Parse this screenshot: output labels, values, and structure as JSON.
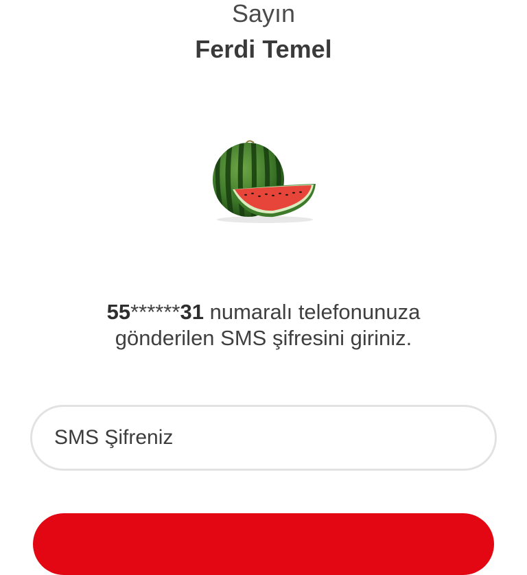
{
  "header": {
    "greeting": "Sayın",
    "name": "Ferdi Temel"
  },
  "image": {
    "icon": "watermelon-icon"
  },
  "message": {
    "prefix": "55",
    "mask": "******",
    "suffix": "31",
    "line1_rest": " numaralı telefonunuza",
    "line2": "gönderilen SMS şifresini giriniz."
  },
  "sms_input": {
    "placeholder": "SMS Şifreniz",
    "value": ""
  },
  "colors": {
    "brand_red": "#e30613",
    "border_gray": "#e2e2e2"
  }
}
